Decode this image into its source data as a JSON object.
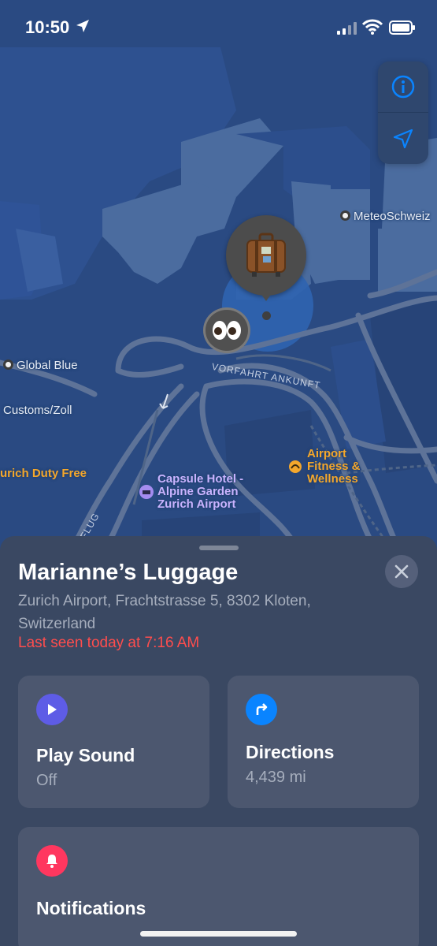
{
  "status_bar": {
    "time": "10:50"
  },
  "map": {
    "labels": {
      "meteo": "MeteoSchweiz",
      "global_blue": "Global Blue",
      "customs": "Customs/Zoll",
      "duty_free": "urich Duty Free",
      "fitness_line1": "Airport",
      "fitness_line2": "Fitness &",
      "fitness_line3": "Wellness",
      "hotel_line1": "Capsule Hotel -",
      "hotel_line2": "Alpine Garden",
      "hotel_line3": "Zurich Airport",
      "street_arrival": "VORFAHRT ANKUNFT",
      "street_flug": "FLUG"
    },
    "marker_icon": "suitcase-icon",
    "memoji_icon": "eyes-icon",
    "controls": [
      "info-icon",
      "location-arrow-icon"
    ]
  },
  "item": {
    "name": "Marianne’s Luggage",
    "address": "Zurich Airport, Frachtstrasse 5, 8302 Kloten, Switzerland",
    "last_seen": "Last seen today at 7:16 AM"
  },
  "actions": {
    "play_sound": {
      "label": "Play Sound",
      "sub": "Off",
      "color": "#5e5ce6"
    },
    "directions": {
      "label": "Directions",
      "sub": "4,439 mi",
      "color": "#0a84ff"
    },
    "notifications": {
      "label": "Notifications",
      "color": "#ff375f"
    }
  },
  "colors": {
    "map_bg": "#2a4a82",
    "sheet_bg": "#3a4862",
    "alert_red": "#ff4d4d",
    "poi_orange": "#f4a72c"
  }
}
